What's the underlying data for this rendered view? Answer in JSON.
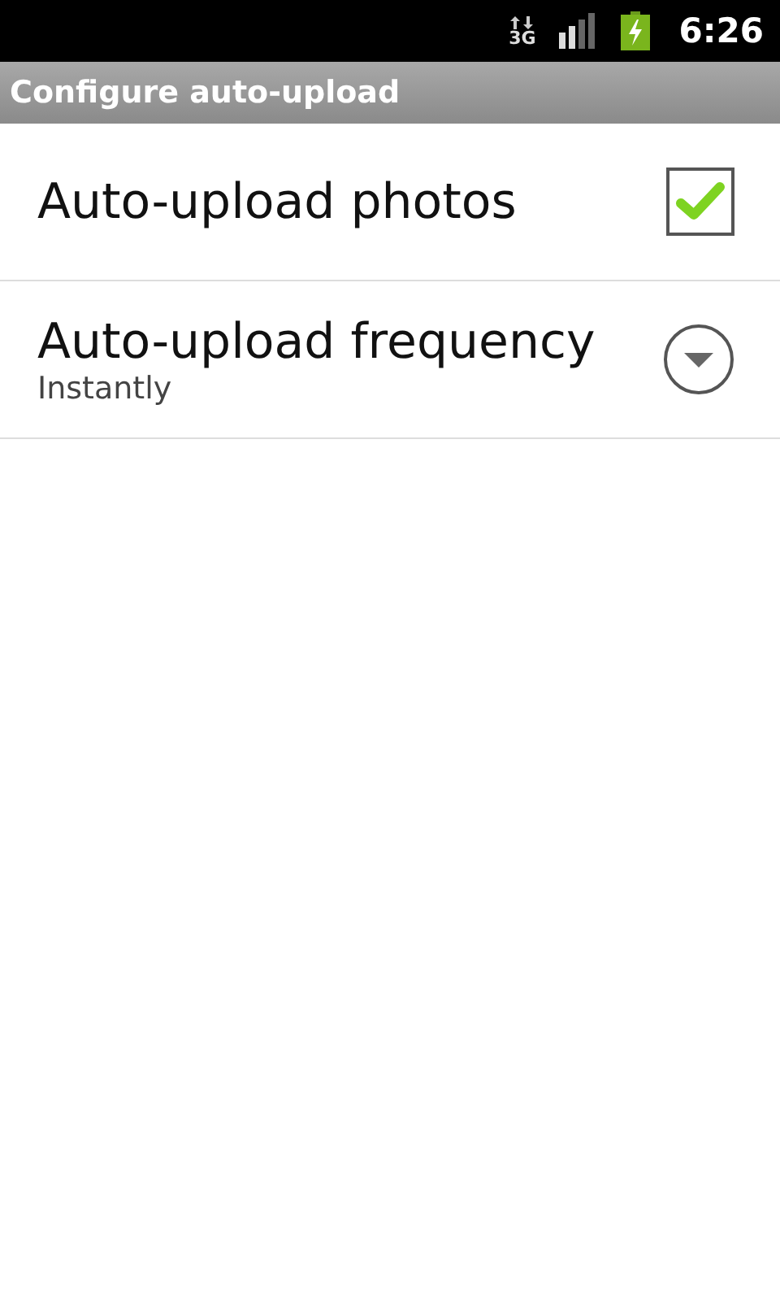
{
  "status_bar": {
    "network": "3G",
    "time": "6:26"
  },
  "title": "Configure auto-upload",
  "settings": [
    {
      "kind": "checkbox",
      "title": "Auto-upload photos",
      "checked": true
    },
    {
      "kind": "dropdown",
      "title": "Auto-upload frequency",
      "summary": "Instantly"
    }
  ]
}
